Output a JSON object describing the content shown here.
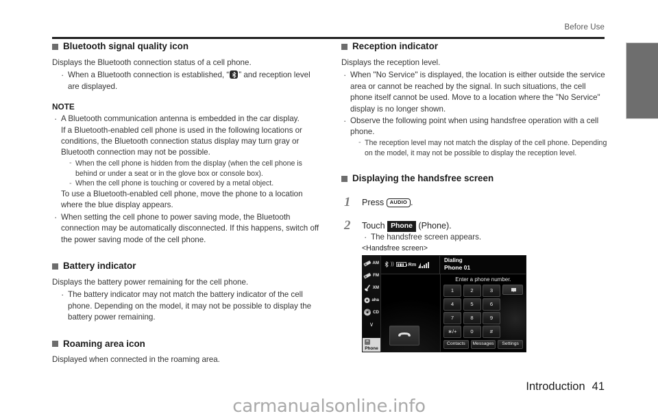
{
  "page": {
    "running_head": "Before Use",
    "footer_section": "Introduction",
    "footer_page": "41",
    "watermark": "carmanualsonline.info"
  },
  "left_column": {
    "bluetooth_section": {
      "heading": "Bluetooth signal quality icon",
      "intro": "Displays the Bluetooth connection status of a cell phone.",
      "bullet_pre": "When a Bluetooth connection is established, “",
      "bullet_post": "” and reception level are displayed."
    },
    "note": {
      "title": "NOTE",
      "bullet1_line1": "A Bluetooth communication antenna is embedded in the car display.",
      "bullet1_line2": "If a Bluetooth-enabled cell phone is used in the following locations or conditions, the Bluetooth connection status display may turn gray or Bluetooth connection may not be possible.",
      "dashes": [
        "When the cell phone is hidden from the display (when the cell phone is behind or under a seat or in the glove box or console box).",
        "When the cell phone is touching or covered by a metal object."
      ],
      "bullet1_line3": "To use a Bluetooth-enabled cell phone, move the phone to a location where the blue display appears.",
      "bullet2": "When setting the cell phone to power saving mode, the Bluetooth connection may be automatically disconnected. If this happens, switch off the power saving mode of the cell phone."
    },
    "battery_section": {
      "heading": "Battery indicator",
      "intro": "Displays the battery power remaining for the cell phone.",
      "bullet1": "The battery indicator may not match the battery indicator of the cell phone. Depending on the model, it may not be possible to display the battery power remaining."
    },
    "roaming_section": {
      "heading": "Roaming area icon",
      "intro": "Displayed when connected in the roaming area."
    }
  },
  "right_column": {
    "reception_section": {
      "heading": "Reception indicator",
      "intro": "Displays the reception level.",
      "bullet1": "When \"No Service\" is displayed, the location is either outside the service area or cannot be reached by the signal. In such situations, the cell phone itself cannot be used. Move to a location where the \"No Service\" display is no longer shown.",
      "bullet2": "Observe the following point when using handsfree operation with a cell phone.",
      "dash1": "The reception level may not match the display of the cell phone. Depending on the model, it may not be possible to display the reception level."
    },
    "handsfree_section": {
      "heading": "Displaying the handsfree screen",
      "step1": {
        "number": "1",
        "text_pre": "Press ",
        "key_label": "AUDIO",
        "text_post": "."
      },
      "step2": {
        "number": "2",
        "text_pre": "Touch ",
        "touch_key": "Phone",
        "text_post": "(Phone).",
        "bullet": "The handsfree screen appears.",
        "caption": "<Handsfree screen>"
      }
    }
  },
  "handsfree_screen": {
    "rail": [
      {
        "label": "AM",
        "icon": "radio-am-icon"
      },
      {
        "label": "FM",
        "icon": "radio-fm-icon"
      },
      {
        "label": "XM",
        "icon": "satellite-xm-icon"
      },
      {
        "label": "aha",
        "icon": "aha-icon"
      },
      {
        "label": "CD",
        "icon": "cd-disc-icon"
      },
      {
        "label": "∨",
        "icon": "chevron-down-icon"
      },
      {
        "label": "Phone",
        "icon": "phone-handset-icon"
      }
    ],
    "status": {
      "roaming_label": "Rm"
    },
    "call_info": {
      "line1": "Dialing",
      "line2": "Phone 01"
    },
    "prompt": "Enter a phone number.",
    "keys": [
      "1",
      "2",
      "3",
      "4",
      "5",
      "6",
      "7",
      "8",
      "9",
      "∗/+",
      "0",
      "#"
    ],
    "tabs": [
      "Contacts",
      "Messages",
      "Settings"
    ]
  }
}
